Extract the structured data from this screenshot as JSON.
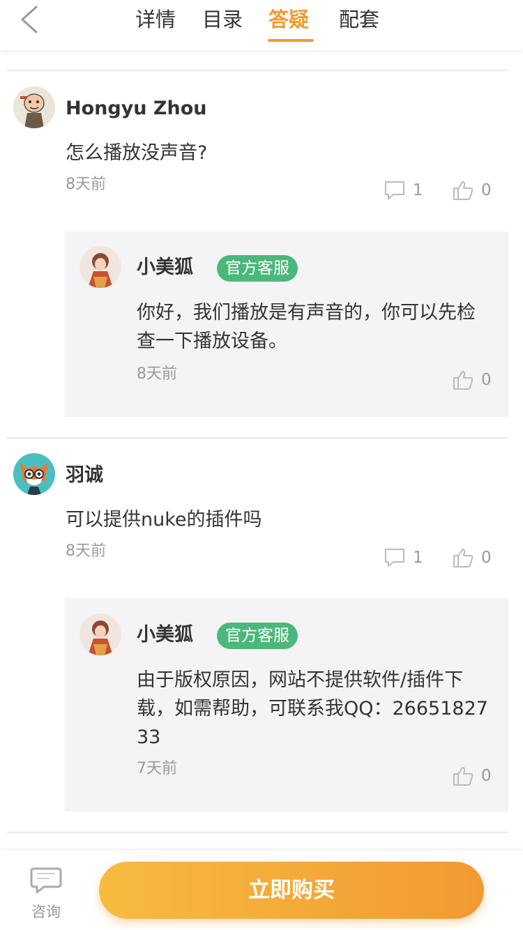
{
  "header": {
    "tabs": [
      {
        "label": "详情"
      },
      {
        "label": "目录"
      },
      {
        "label": "答疑",
        "active": true
      },
      {
        "label": "配套"
      }
    ]
  },
  "threads": [
    {
      "user": "Hongyu Zhou",
      "question": "怎么播放没声音?",
      "time": "8天前",
      "comments": "1",
      "likes": "0",
      "reply": {
        "user": "小美狐",
        "badge": "官方客服",
        "text": "你好，我们播放是有声音的，你可以先检查一下播放设备。",
        "time": "8天前",
        "likes": "0"
      }
    },
    {
      "user": "羽诚",
      "question": "可以提供nuke的插件吗",
      "time": "8天前",
      "comments": "1",
      "likes": "0",
      "reply": {
        "user": "小美狐",
        "badge": "官方客服",
        "text": "由于版权原因，网站不提供软件/插件下载，如需帮助，可联系我QQ：2665182733",
        "time": "7天前",
        "likes": "0"
      }
    }
  ],
  "footer": {
    "consult_label": "咨询",
    "buy_label": "立即购买"
  },
  "colors": {
    "accent": "#f39a2f",
    "badge": "#4cb77b",
    "reply_bg": "#f4f4f6"
  }
}
